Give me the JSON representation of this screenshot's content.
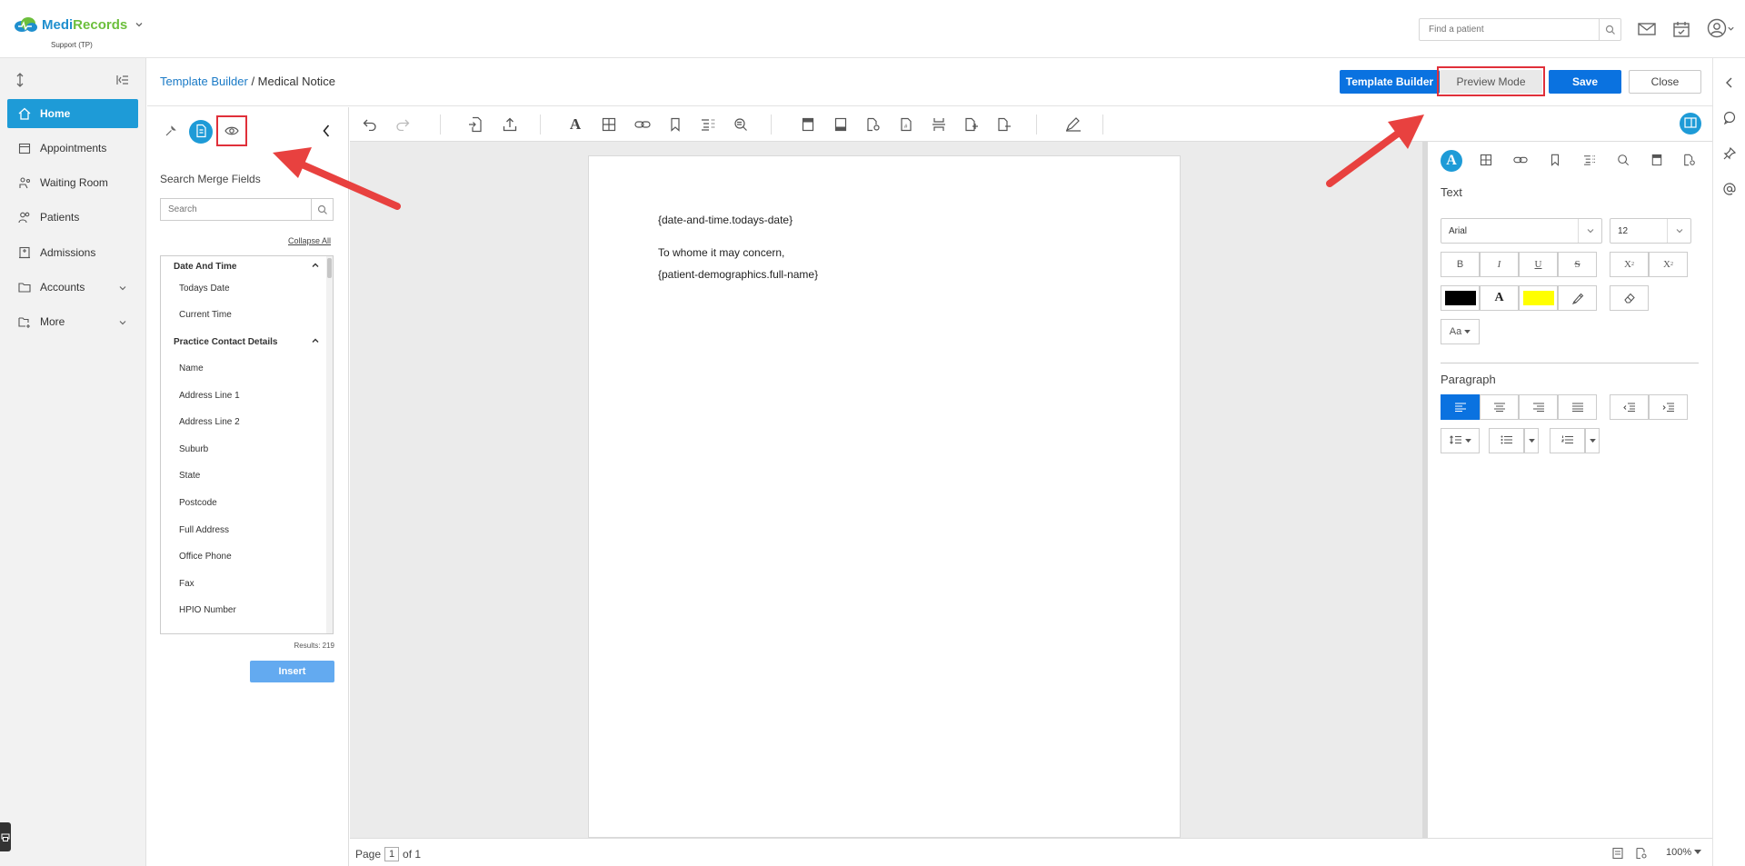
{
  "app": {
    "brand": "MediRecords",
    "brand_prefix": "Medi",
    "brand_suffix": "Records",
    "subtitle": "Support (TP)",
    "find_patient_placeholder": "Find a patient"
  },
  "nav": {
    "items": [
      {
        "label": "Home",
        "icon": "home-icon"
      },
      {
        "label": "Appointments",
        "icon": "calendar-icon"
      },
      {
        "label": "Waiting Room",
        "icon": "waiting-room-icon"
      },
      {
        "label": "Patients",
        "icon": "patients-icon"
      },
      {
        "label": "Admissions",
        "icon": "admissions-icon"
      },
      {
        "label": "Accounts",
        "icon": "folder-icon"
      },
      {
        "label": "More",
        "icon": "more-icon"
      }
    ]
  },
  "breadcrumb": {
    "root": "Template Builder",
    "separator": " / ",
    "current": "Medical Notice"
  },
  "actions": {
    "template_builder": "Template Builder",
    "preview_mode": "Preview Mode",
    "save": "Save",
    "close": "Close"
  },
  "merge": {
    "title": "Search Merge Fields",
    "search_placeholder": "Search",
    "collapse_all": "Collapse All",
    "groups": [
      {
        "label": "Date And Time",
        "items": [
          "Todays Date",
          "Current Time"
        ]
      },
      {
        "label": "Practice Contact Details",
        "items": [
          "Name",
          "Address Line 1",
          "Address Line 2",
          "Suburb",
          "State",
          "Postcode",
          "Full Address",
          "Office Phone",
          "Fax",
          "HPIO Number"
        ]
      }
    ],
    "results": "Results: 219",
    "insert": "Insert"
  },
  "document": {
    "lines": [
      "{date-and-time.todays-date}",
      "To whome it may concern,",
      "{patient-demographics.full-name}"
    ]
  },
  "status": {
    "page_label": "Page",
    "page_number": "1",
    "page_of": "of 1",
    "zoom": "100%"
  },
  "format": {
    "text_title": "Text",
    "font": "Arial",
    "size": "12",
    "bold": "B",
    "italic": "I",
    "underline": "U",
    "strike": "S",
    "superscript": "X",
    "subscript": "X",
    "text_color_label": "A",
    "case_label": "Aa",
    "paragraph_title": "Paragraph",
    "colors": {
      "font": "#000000",
      "highlight": "#ffff00",
      "accent": "#1e9bd7",
      "primary": "#0a72e0",
      "annotation": "#e0303a"
    }
  }
}
